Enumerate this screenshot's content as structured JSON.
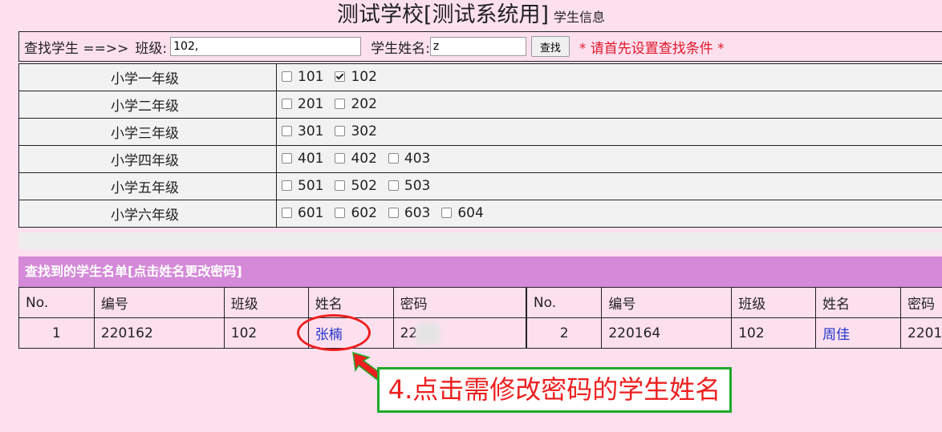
{
  "header": {
    "title": "测试学校[测试系统用]",
    "subtitle": "学生信息"
  },
  "search": {
    "prefix": "查找学生 ==>>",
    "class_label": "班级:",
    "class_value": "102,",
    "name_label": "学生姓名:",
    "name_value": "z",
    "button": "查找",
    "hint": "* 请首先设置查找条件 *"
  },
  "grades": [
    {
      "name": "小学一年级",
      "classes": [
        {
          "code": "101",
          "checked": false
        },
        {
          "code": "102",
          "checked": true
        }
      ]
    },
    {
      "name": "小学二年级",
      "classes": [
        {
          "code": "201",
          "checked": false
        },
        {
          "code": "202",
          "checked": false
        }
      ]
    },
    {
      "name": "小学三年级",
      "classes": [
        {
          "code": "301",
          "checked": false
        },
        {
          "code": "302",
          "checked": false
        }
      ]
    },
    {
      "name": "小学四年级",
      "classes": [
        {
          "code": "401",
          "checked": false
        },
        {
          "code": "402",
          "checked": false
        },
        {
          "code": "403",
          "checked": false
        }
      ]
    },
    {
      "name": "小学五年级",
      "classes": [
        {
          "code": "501",
          "checked": false
        },
        {
          "code": "502",
          "checked": false
        },
        {
          "code": "503",
          "checked": false
        }
      ]
    },
    {
      "name": "小学六年级",
      "classes": [
        {
          "code": "601",
          "checked": false
        },
        {
          "code": "602",
          "checked": false
        },
        {
          "code": "603",
          "checked": false
        },
        {
          "code": "604",
          "checked": false
        }
      ]
    }
  ],
  "results": {
    "heading": "查找到的学生名单[点击姓名更改密码]",
    "columns": [
      "No.",
      "编号",
      "班级",
      "姓名",
      "密码"
    ],
    "students": [
      {
        "no": "1",
        "id": "220162",
        "class": "102",
        "name": "张楠",
        "password": "22"
      },
      {
        "no": "2",
        "id": "220164",
        "class": "102",
        "name": "周佳",
        "password": "2201"
      }
    ]
  },
  "annotation": {
    "text": "4.点击需修改密码的学生姓名",
    "circle_color": "#ee1f1f",
    "box_color": "#1faa2a"
  },
  "colors": {
    "page_bg": "#fde0ee",
    "list_header_bg": "#d48ad8",
    "link": "#2233cc",
    "warning": "#e0182a"
  }
}
